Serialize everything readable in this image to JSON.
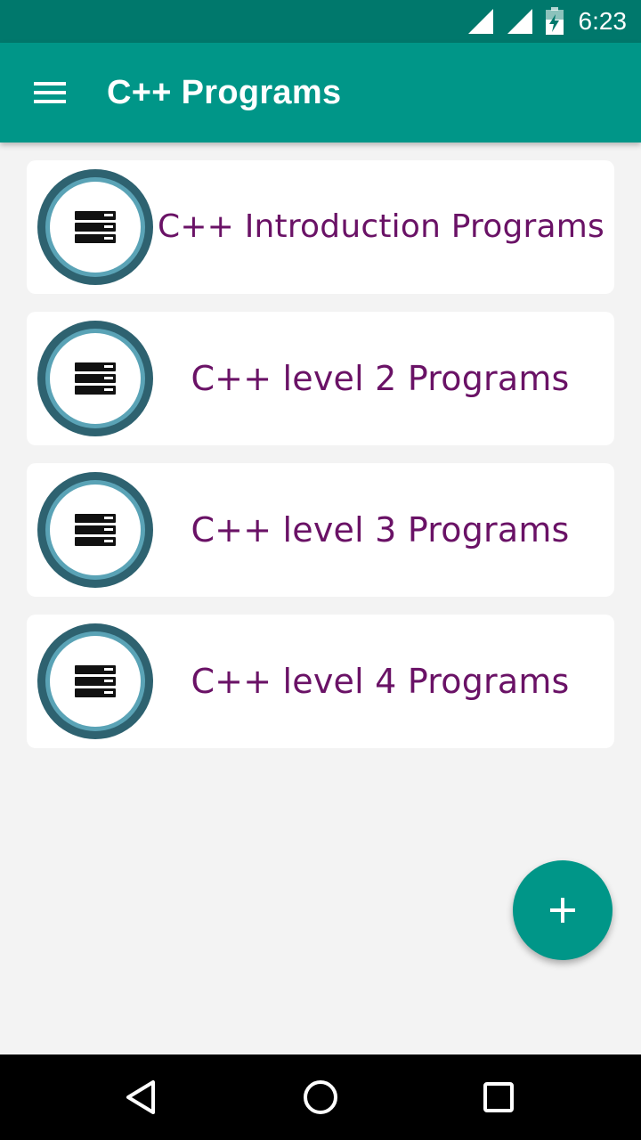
{
  "status_bar": {
    "time": "6:23"
  },
  "app_bar": {
    "title": "C++ Programs"
  },
  "items": [
    {
      "label": "C++ Introduction Programs"
    },
    {
      "label": "C++ level 2 Programs"
    },
    {
      "label": "C++ level 3 Programs"
    },
    {
      "label": "C++ level 4 Programs"
    }
  ],
  "icons": {
    "menu": "menu-icon",
    "item": "server-icon",
    "fab": "plus-icon",
    "nav_back": "back-triangle-icon",
    "nav_home": "home-circle-icon",
    "nav_recents": "recents-square-icon"
  },
  "colors": {
    "status_bar": "#00786c",
    "app_bar": "#009688",
    "accent": "#009688",
    "item_text": "#6a1266",
    "icon_ring_outer": "#2e6270",
    "icon_ring_inner": "#5aa3b6",
    "background": "#f3f3f3"
  }
}
